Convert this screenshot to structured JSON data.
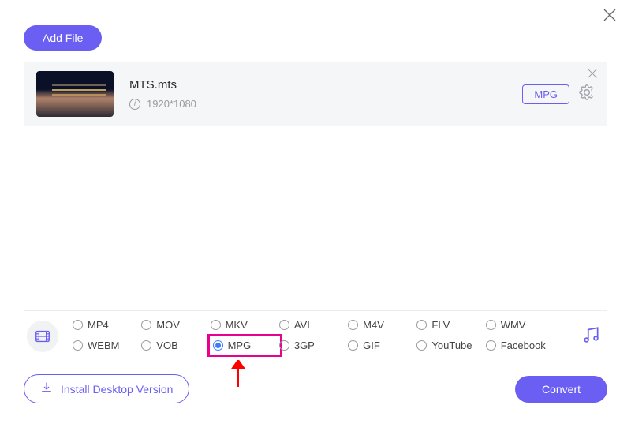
{
  "header": {
    "add_file_label": "Add File"
  },
  "file": {
    "name": "MTS.mts",
    "resolution": "1920*1080",
    "target_format": "MPG"
  },
  "formats": {
    "row1": [
      "MP4",
      "MOV",
      "MKV",
      "AVI",
      "M4V",
      "FLV",
      "WMV"
    ],
    "row2": [
      "WEBM",
      "VOB",
      "MPG",
      "3GP",
      "GIF",
      "YouTube",
      "Facebook"
    ],
    "selected": "MPG"
  },
  "footer": {
    "install_label": "Install Desktop Version",
    "convert_label": "Convert"
  }
}
